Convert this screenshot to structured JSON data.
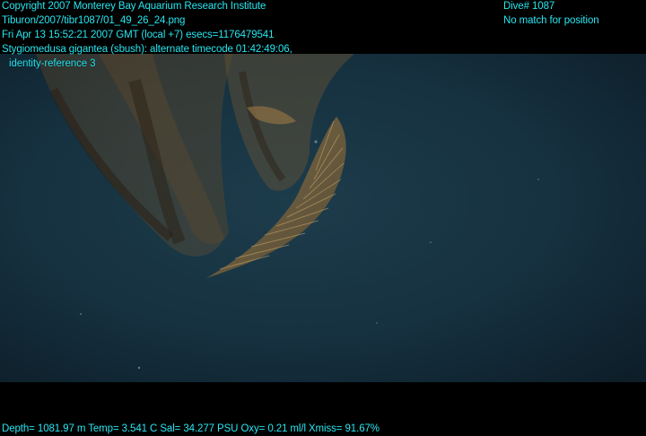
{
  "overlay": {
    "top_left": {
      "copyright": "Copyright 2007 Monterey Bay Aquarium Research Institute",
      "file": "Tiburon/2007/tibr1087/01_49_26_24.png",
      "timestamp": "Fri Apr 13 15:52:21 2007 GMT (local +7)  esecs=1176479541",
      "annotation": "Stygiomedusa gigantea (sbush): alternate timecode 01:42:49:06,",
      "annotation_cont": "identity-reference 3"
    },
    "top_right": {
      "dive": "Dive# 1087",
      "position": "No match for position"
    },
    "bottom": {
      "sensors": "Depth= 1081.97 m  Temp= 3.541 C  Sal= 34.277 PSU  Oxy= 0.21 ml/l  Xmiss= 91.67%"
    }
  },
  "colors": {
    "overlay_text": "#27e6f0",
    "water_deep": "#0f2330",
    "water_light": "#1b3947",
    "medusa_bell": "#8a6a3a",
    "medusa_arm": "#3b2a1a"
  }
}
